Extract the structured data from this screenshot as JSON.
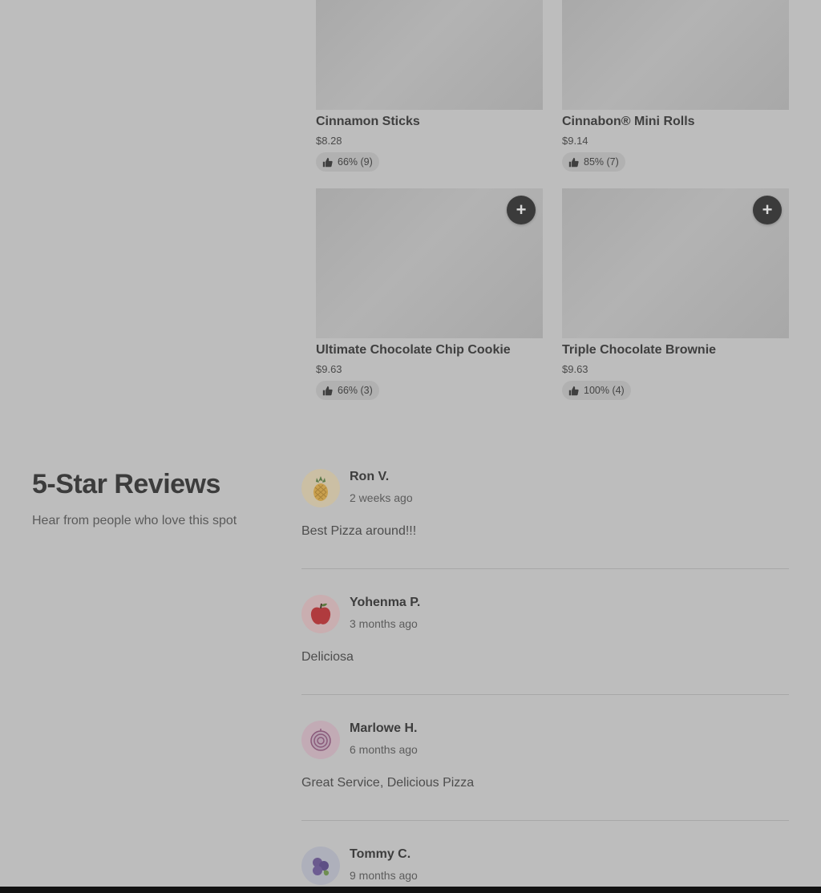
{
  "items": [
    {
      "name": "Cinnamon Sticks",
      "price": "$8.28",
      "rating": "66% (9)"
    },
    {
      "name": "Cinnabon® Mini Rolls",
      "price": "$9.14",
      "rating": "85% (7)"
    },
    {
      "name": "Ultimate Chocolate Chip Cookie",
      "price": "$9.63",
      "rating": "66% (3)"
    },
    {
      "name": "Triple Chocolate Brownie",
      "price": "$9.63",
      "rating": "100% (4)"
    }
  ],
  "add_label": "+",
  "reviews_section": {
    "title": "5-Star Reviews",
    "subtitle": "Hear from people who love this spot"
  },
  "reviews": [
    {
      "name": "Ron V.",
      "time": "2 weeks ago",
      "text": "Best Pizza around!!!",
      "avatar_icon": "pineapple-icon"
    },
    {
      "name": "Yohenma P.",
      "time": "3 months ago",
      "text": "Deliciosa",
      "avatar_icon": "apple-icon"
    },
    {
      "name": "Marlowe H.",
      "time": "6 months ago",
      "text": "Great Service, Delicious Pizza",
      "avatar_icon": "onion-icon"
    },
    {
      "name": "Tommy C.",
      "time": "9 months ago",
      "text": "",
      "avatar_icon": "blueberries-icon"
    }
  ],
  "colors": {
    "overlay_bg": "#bdbdbd",
    "add_button": "#3b3b3b"
  }
}
